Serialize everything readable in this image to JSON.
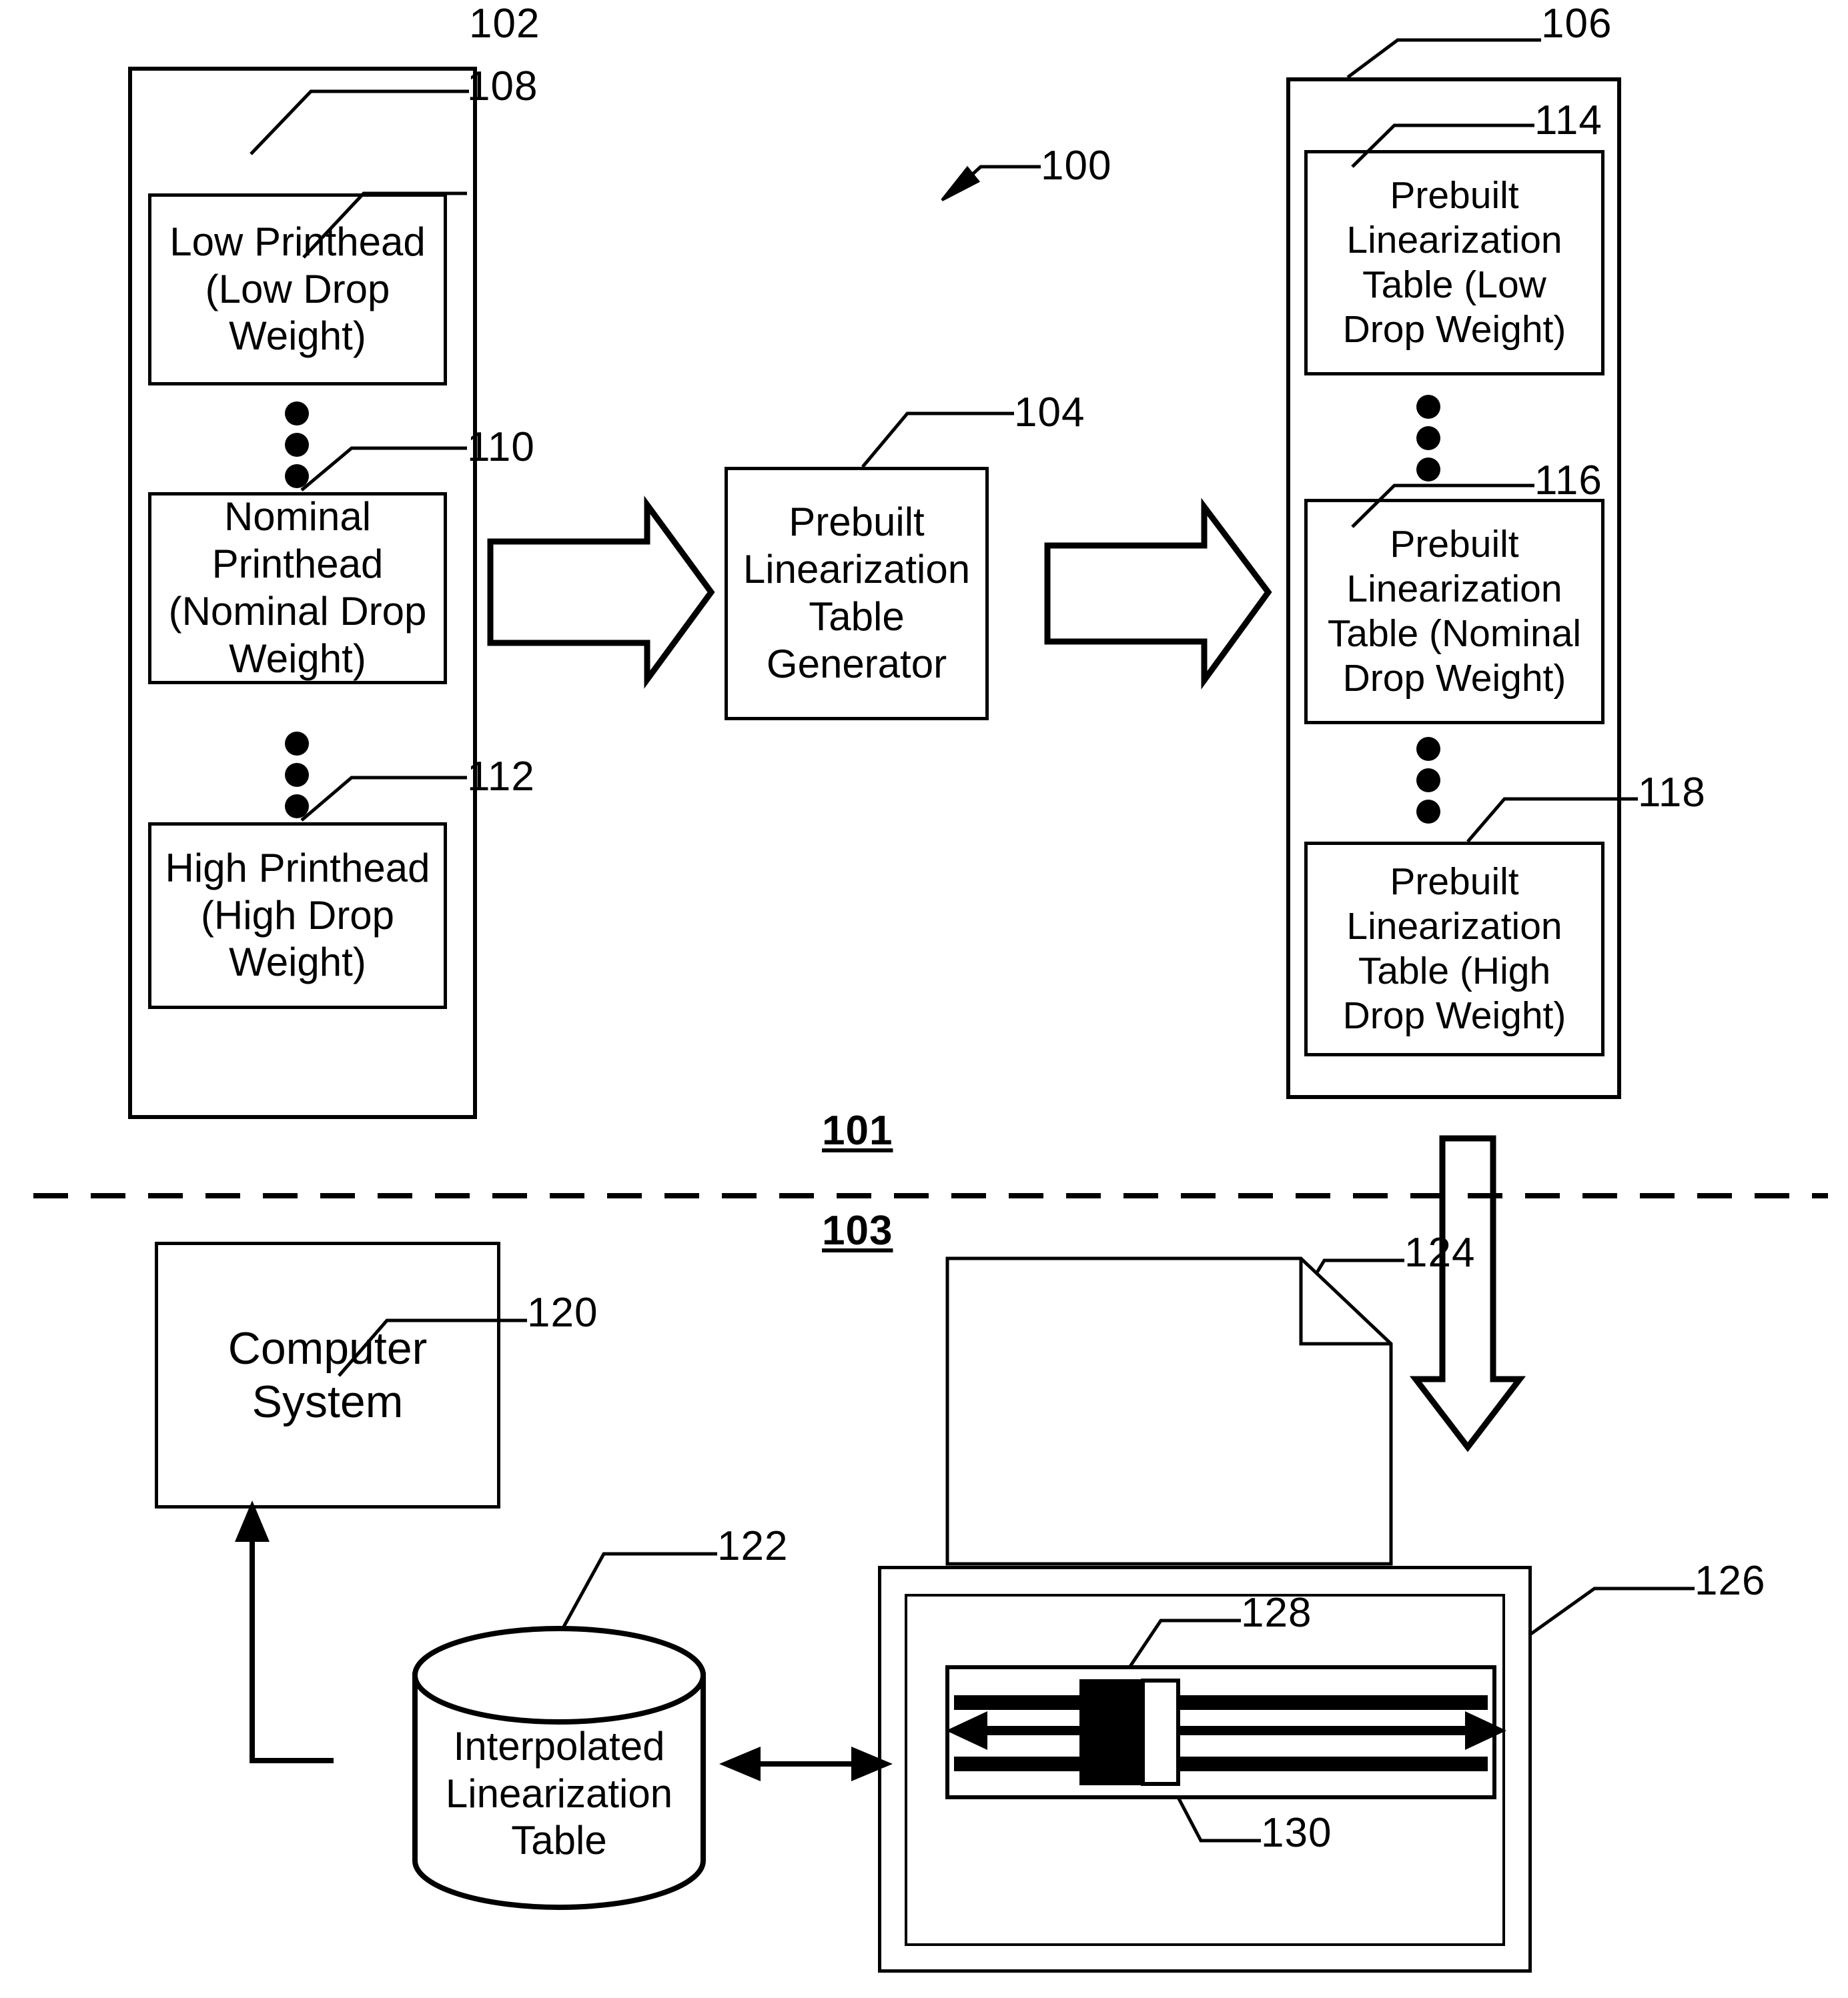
{
  "figure": {
    "overall_ref": "100",
    "section_upper_ref": "101",
    "section_lower_ref": "103"
  },
  "printhead_group": {
    "ref": "102",
    "items": [
      {
        "ref": "108",
        "label": "Low Printhead\n(Low Drop\nWeight)"
      },
      {
        "ref": "110",
        "label": "Nominal\nPrinthead\n(Nominal Drop\nWeight)"
      },
      {
        "ref": "112",
        "label": "High Printhead\n(High Drop\nWeight)"
      }
    ]
  },
  "generator": {
    "ref": "104",
    "label": "Prebuilt\nLinearization\nTable\nGenerator"
  },
  "tables_group": {
    "ref": "106",
    "items": [
      {
        "ref": "114",
        "label": "Prebuilt\nLinearization\nTable (Low\nDrop Weight)"
      },
      {
        "ref": "116",
        "label": "Prebuilt\nLinearization\nTable (Nominal\nDrop Weight)"
      },
      {
        "ref": "118",
        "label": "Prebuilt\nLinearization\nTable (High\nDrop Weight)"
      }
    ]
  },
  "runtime": {
    "computer_system": {
      "ref": "120",
      "label": "Computer\nSystem"
    },
    "interpolated_table": {
      "ref": "122",
      "label": "Interpolated\nLinearization\nTable"
    },
    "media_sheet": {
      "ref": "124"
    },
    "printer": {
      "ref": "126"
    },
    "printhead_carriage": {
      "ref": "128"
    },
    "carriage_block": {
      "ref": "130"
    }
  },
  "colors": {
    "ink": "#000000",
    "paper": "#ffffff"
  }
}
